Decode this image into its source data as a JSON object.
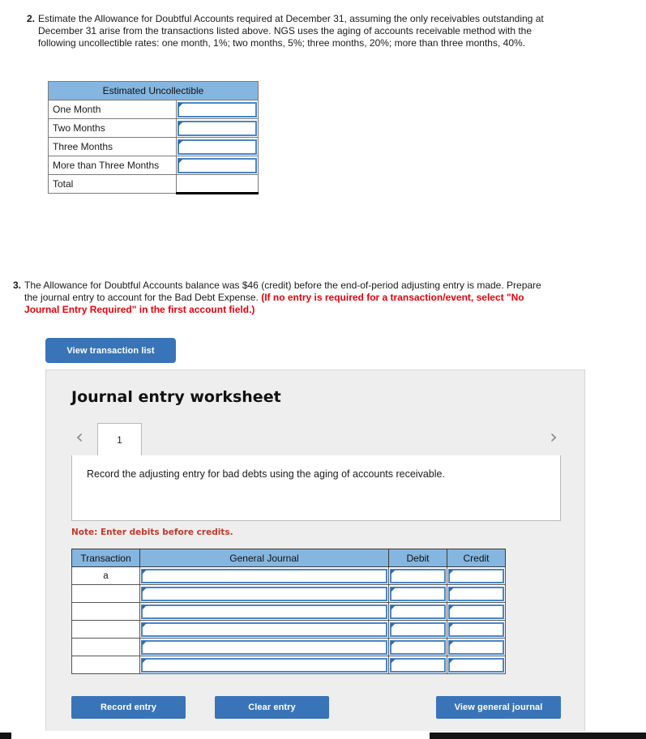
{
  "questions": {
    "q2": {
      "number": "2.",
      "text": "Estimate the Allowance for Doubtful Accounts required at December 31, assuming the only receivables outstanding at December 31 arise from the transactions listed above. NGS uses the aging of accounts receivable method with the following uncollectible rates: one month, 1%; two months, 5%; three months, 20%; more than three months, 40%."
    },
    "q3": {
      "number": "3.",
      "text_plain": "The Allowance for Doubtful Accounts balance was $46 (credit) before the end-of-period adjusting entry is made. Prepare the journal entry to account for the Bad Debt Expense. ",
      "text_red": "(If no entry is required for a transaction/event, select \"No Journal Entry Required\" in the first account field.)"
    }
  },
  "estimated_table": {
    "header": "Estimated Uncollectible",
    "rows": [
      {
        "label": "One Month",
        "value": "",
        "input": true
      },
      {
        "label": "Two Months",
        "value": "",
        "input": true
      },
      {
        "label": "Three Months",
        "value": "",
        "input": true
      },
      {
        "label": "More than Three Months",
        "value": "",
        "input": true
      },
      {
        "label": "Total",
        "value": "",
        "input": false
      }
    ]
  },
  "buttons": {
    "view_transaction_list": "View transaction list",
    "record_entry": "Record entry",
    "clear_entry": "Clear entry",
    "view_general_journal": "View general journal"
  },
  "worksheet": {
    "title": "Journal entry worksheet",
    "nav": {
      "prev_icon": "‹",
      "next_icon": "›"
    },
    "tabs": [
      {
        "label": "1",
        "active": true
      }
    ],
    "description": "Record the adjusting entry for bad debts using the aging of accounts receivable.",
    "note": "Note: Enter debits before credits.",
    "journal": {
      "columns": [
        "Transaction",
        "General Journal",
        "Debit",
        "Credit"
      ],
      "rows": [
        {
          "transaction": "a",
          "general_journal": "",
          "debit": "",
          "credit": ""
        },
        {
          "transaction": "",
          "general_journal": "",
          "debit": "",
          "credit": ""
        },
        {
          "transaction": "",
          "general_journal": "",
          "debit": "",
          "credit": ""
        },
        {
          "transaction": "",
          "general_journal": "",
          "debit": "",
          "credit": ""
        },
        {
          "transaction": "",
          "general_journal": "",
          "debit": "",
          "credit": ""
        },
        {
          "transaction": "",
          "general_journal": "",
          "debit": "",
          "credit": ""
        }
      ]
    }
  },
  "colors": {
    "header_blue": "#85b6e0",
    "button_blue": "#3a74b8",
    "field_border_blue": "#4a86c5",
    "red_text": "#e8000b",
    "note_red": "#c0392b",
    "panel_gray": "#eeeeee"
  }
}
